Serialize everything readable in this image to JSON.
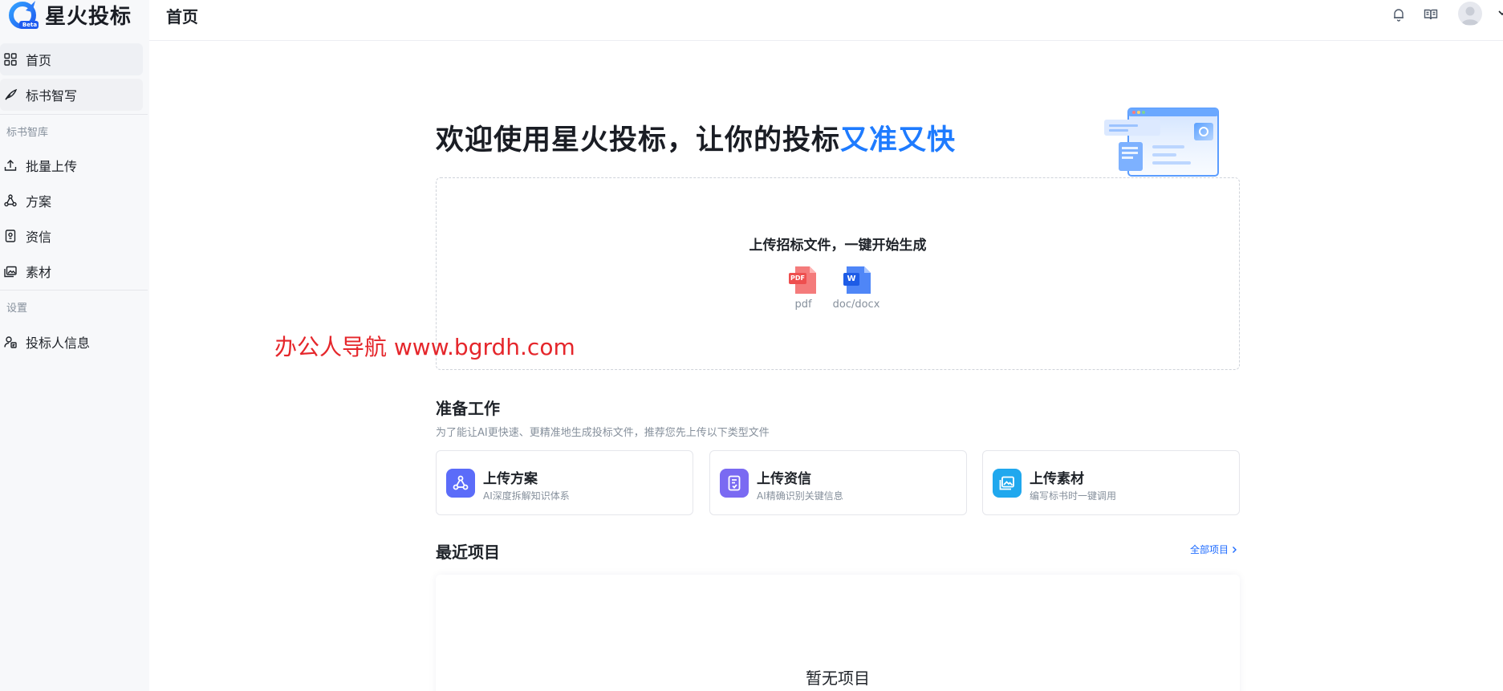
{
  "brand": {
    "name": "星火投标",
    "badge": "Beta"
  },
  "sidebar": {
    "items": [
      {
        "label": "首页",
        "icon": "grid-icon"
      },
      {
        "label": "标书智写",
        "icon": "quill-icon"
      }
    ],
    "section_library": "标书智库",
    "library_items": [
      {
        "label": "批量上传",
        "icon": "upload-icon"
      },
      {
        "label": "方案",
        "icon": "network-icon"
      },
      {
        "label": "资信",
        "icon": "credential-icon"
      },
      {
        "label": "素材",
        "icon": "image-icon"
      }
    ],
    "section_settings": "设置",
    "settings_items": [
      {
        "label": "投标人信息",
        "icon": "bidder-icon"
      }
    ]
  },
  "header": {
    "title": "首页"
  },
  "welcome": {
    "text": "欢迎使用星火投标，让你的投标",
    "highlight": "又准又快"
  },
  "upload": {
    "title": "上传招标文件，一键开始生成",
    "types": [
      {
        "label": "pdf",
        "badge": "PDF",
        "color": "#f05454"
      },
      {
        "label": "doc/docx",
        "badge": "W",
        "color": "#2d6cf6"
      }
    ]
  },
  "watermark": "办公人导航 www.bgrdh.com",
  "prepare": {
    "title": "准备工作",
    "subtitle": "为了能让AI更快速、更精准地生成投标文件，推荐您先上传以下类型文件",
    "cards": [
      {
        "title": "上传方案",
        "subtitle": "AI深度拆解知识体系",
        "color": "#5b6cf9"
      },
      {
        "title": "上传资信",
        "subtitle": "AI精确识别关键信息",
        "color": "#7a6af2"
      },
      {
        "title": "上传素材",
        "subtitle": "编写标书时一键调用",
        "color": "#20a8ee"
      }
    ]
  },
  "recent": {
    "title": "最近项目",
    "all_link": "全部项目",
    "empty": "暂无项目"
  }
}
